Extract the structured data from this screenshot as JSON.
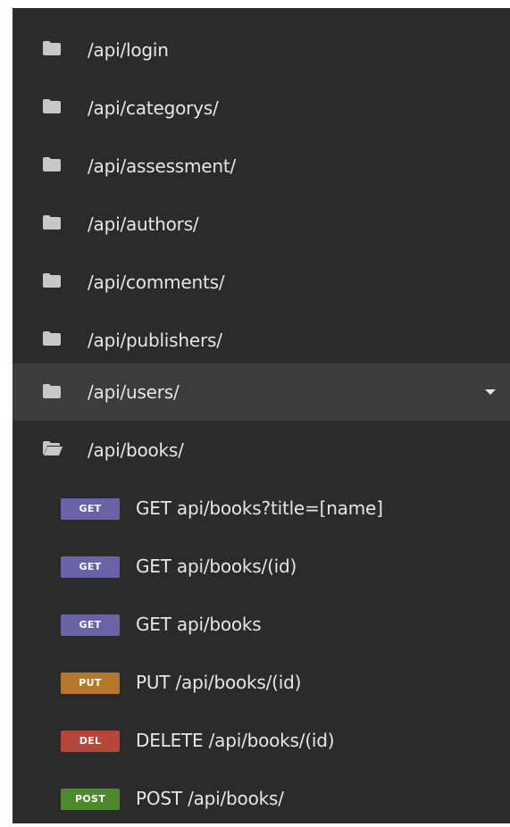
{
  "colors": {
    "panel_bg": "#2b2b2b",
    "hover_bg": "#3c3c3c",
    "text": "#e6e6e6",
    "icon": "#c8c8c8",
    "get": "#6b63a8",
    "put": "#b5782b",
    "delete": "#b5463a",
    "post": "#4d8a2e"
  },
  "folders": [
    {
      "label": "/api/login",
      "icon": "folder-closed-icon"
    },
    {
      "label": "/api/categorys/",
      "icon": "folder-closed-icon"
    },
    {
      "label": "/api/assessment/",
      "icon": "folder-closed-icon"
    },
    {
      "label": "/api/authors/",
      "icon": "folder-closed-icon"
    },
    {
      "label": "/api/comments/",
      "icon": "folder-closed-icon"
    },
    {
      "label": "/api/publishers/",
      "icon": "folder-closed-icon"
    },
    {
      "label": "/api/users/",
      "icon": "folder-closed-icon",
      "menu_icon": "caret-down-icon"
    },
    {
      "label": "/api/books/",
      "icon": "folder-open-icon"
    }
  ],
  "requests": [
    {
      "method": "GET",
      "label": "GET api/books?title=[name]"
    },
    {
      "method": "GET",
      "label": "GET api/books/(id)"
    },
    {
      "method": "GET",
      "label": "GET api/books"
    },
    {
      "method": "PUT",
      "label": "PUT /api/books/(id)"
    },
    {
      "method": "DEL",
      "label": "DELETE /api/books/(id)"
    },
    {
      "method": "POST",
      "label": "POST /api/books/"
    }
  ]
}
